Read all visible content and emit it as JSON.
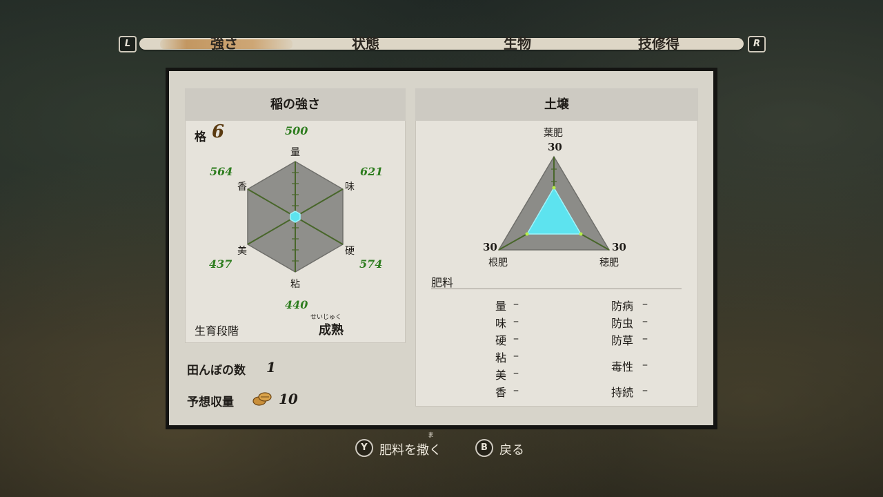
{
  "tabs": {
    "left_key": "L",
    "right_key": "R",
    "items": [
      "強さ",
      "状態",
      "生物",
      "技修得"
    ],
    "active_index": 0
  },
  "rice": {
    "title": "稲の強さ",
    "rank_label": "格",
    "rank_value": "6",
    "stats": [
      {
        "label": "量",
        "value": "500"
      },
      {
        "label": "味",
        "value": "621"
      },
      {
        "label": "硬",
        "value": "574"
      },
      {
        "label": "粘",
        "value": "440"
      },
      {
        "label": "美",
        "value": "437"
      },
      {
        "label": "香",
        "value": "564"
      }
    ],
    "growth_label": "生育段階",
    "growth_furigana": "せいじゅく",
    "growth_value": "成熟",
    "paddy_label": "田んぼの数",
    "paddy_value": "1",
    "yield_label": "予想収量",
    "yield_value": "10"
  },
  "soil": {
    "title": "土壌",
    "axes": [
      {
        "label": "葉肥",
        "value": "30"
      },
      {
        "label": "穂肥",
        "value": "30"
      },
      {
        "label": "根肥",
        "value": "30"
      }
    ],
    "fertilizer_title": "肥料",
    "left_effects": [
      {
        "label": "量",
        "value": "–"
      },
      {
        "label": "味",
        "value": "–"
      },
      {
        "label": "硬",
        "value": "–"
      },
      {
        "label": "粘",
        "value": "–"
      },
      {
        "label": "美",
        "value": "–"
      },
      {
        "label": "香",
        "value": "–"
      }
    ],
    "right_effects": [
      {
        "label": "防病",
        "value": "–"
      },
      {
        "label": "防虫",
        "value": "–"
      },
      {
        "label": "防草",
        "value": "–"
      },
      {
        "label": "毒性",
        "value": "–"
      },
      {
        "label": "持続",
        "value": "–"
      }
    ]
  },
  "prompts": {
    "y_key": "Y",
    "y_furigana": "ま",
    "y_label": "肥料を撒く",
    "b_key": "B",
    "b_label": "戻る"
  },
  "colors": {
    "stat_value_green": "#2e7d1f",
    "chart_fill_cyan": "#5de3ef",
    "chart_bg_gray": "#8c8c88",
    "axis_green": "#4c6b2a"
  }
}
